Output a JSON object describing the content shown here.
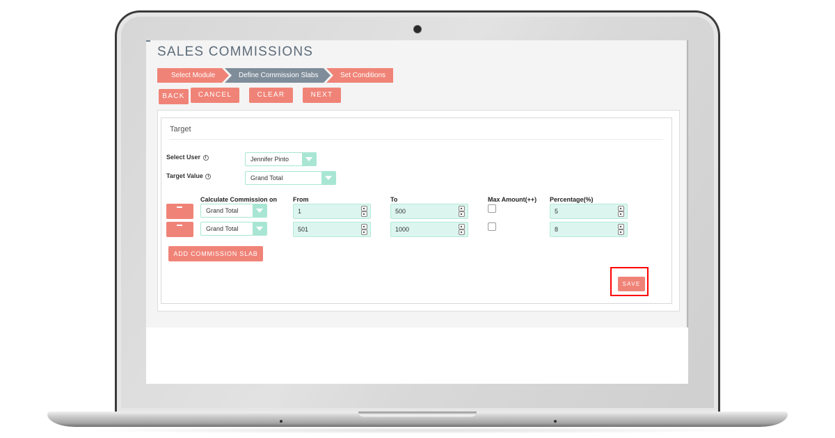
{
  "page": {
    "title": "SALES COMMISSIONS"
  },
  "steps": [
    {
      "label": "Select Module",
      "state": "done"
    },
    {
      "label": "Define Commission Slabs",
      "state": "active"
    },
    {
      "label": "Set Conditions",
      "state": "pending"
    }
  ],
  "toolbar": {
    "back_label": "BACK",
    "cancel_label": "CANCEL",
    "clear_label": "CLEAR",
    "next_label": "NEXT"
  },
  "target": {
    "section_title": "Target",
    "select_user_label": "Select User",
    "select_user_value": "Jennifer Pinto",
    "target_value_label": "Target Value",
    "target_value_value": "Grand Total",
    "info_glyph": "i"
  },
  "slabs": {
    "headers": {
      "calculate_on": "Calculate Commission on",
      "from": "From",
      "to": "To",
      "max_amount": "Max Amount(++)",
      "percentage": "Percentage(%)"
    },
    "rows": [
      {
        "calculate_on": "Grand Total",
        "from": "1",
        "to": "500",
        "max_amount_checked": false,
        "percentage": "5"
      },
      {
        "calculate_on": "Grand Total",
        "from": "501",
        "to": "1000",
        "max_amount_checked": false,
        "percentage": "8"
      }
    ],
    "add_label": "ADD COMMISSION SLAB"
  },
  "actions": {
    "save_label": "SAVE"
  },
  "colors": {
    "accent": "#f08377",
    "step_active": "#7f8d9a",
    "input_fill": "#dcf6ef",
    "input_border": "#a8e6d3",
    "highlight": "#ff0000"
  }
}
